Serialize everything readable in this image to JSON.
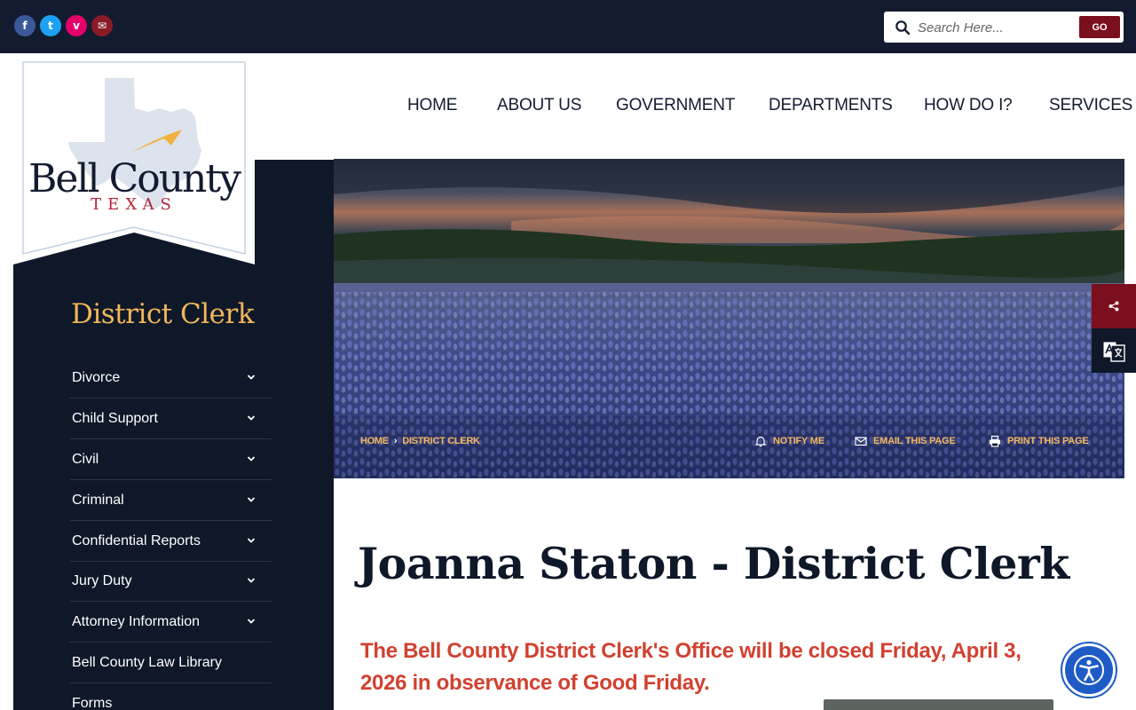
{
  "social": {
    "facebook": "f",
    "twitter": "t",
    "vimeo": "v",
    "email": "✉"
  },
  "search": {
    "placeholder": "Search Here...",
    "go_label": "GO"
  },
  "logo": {
    "line1": "Bell County",
    "line2": "TEXAS"
  },
  "nav": [
    {
      "label": "HOME"
    },
    {
      "label": "ABOUT US"
    },
    {
      "label": "GOVERNMENT"
    },
    {
      "label": "DEPARTMENTS"
    },
    {
      "label": "HOW DO I?"
    },
    {
      "label": "SERVICES"
    }
  ],
  "sidebar": {
    "title": "District Clerk",
    "items": [
      {
        "label": "Divorce",
        "has_children": true
      },
      {
        "label": "Child Support",
        "has_children": true
      },
      {
        "label": "Civil",
        "has_children": true
      },
      {
        "label": "Criminal",
        "has_children": true
      },
      {
        "label": "Confidential Reports",
        "has_children": true
      },
      {
        "label": "Jury Duty",
        "has_children": true
      },
      {
        "label": "Attorney Information",
        "has_children": true
      },
      {
        "label": "Bell County Law Library",
        "has_children": false
      },
      {
        "label": "Forms",
        "has_children": false
      }
    ]
  },
  "breadcrumb": {
    "home": "HOME",
    "current": "DISTRICT CLERK"
  },
  "actions": {
    "notify": "NOTIFY ME",
    "email": "EMAIL THIS PAGE",
    "print": "PRINT THIS PAGE"
  },
  "page": {
    "title": "Joanna Staton - District Clerk",
    "alert": "The Bell County District Clerk's Office will be closed Friday, April 3, 2026 in observance of Good Friday."
  },
  "colors": {
    "navy": "#131b30",
    "sidebar": "#0e1828",
    "gold": "#f2b65b",
    "maroon": "#7b0f1d",
    "alert_red": "#d14130",
    "a11y_blue": "#1e5bc6"
  }
}
